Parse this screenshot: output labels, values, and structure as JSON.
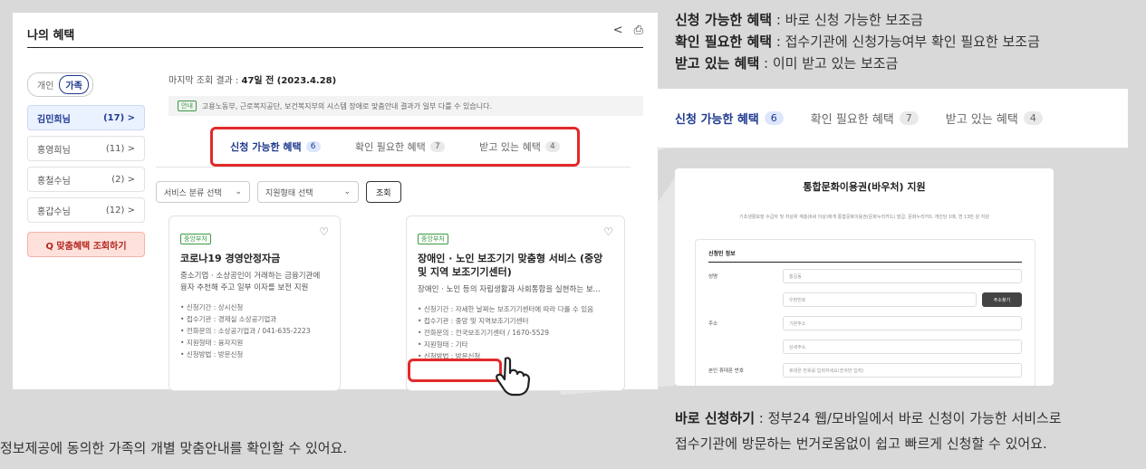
{
  "card": {
    "title": "나의 혜택",
    "toggle": {
      "personal": "개인",
      "family": "가족"
    },
    "people": [
      {
        "name": "김민희님",
        "count": "(17) >"
      },
      {
        "name": "홍영희님",
        "count": "(11) >"
      },
      {
        "name": "홍철수님",
        "count": "(2) >"
      },
      {
        "name": "홍갑수님",
        "count": "(12) >"
      }
    ],
    "match_button": "Q 맞춤혜택 조회하기",
    "last_query_prefix": "마지막 조회 결과 : ",
    "last_query_value": "47일 전 (2023.4.28)",
    "notice_tag": "안내",
    "notice_text": "고용노동부, 근로복지공단, 보건복지부의 시스템 장애로 맞춤안내 결과가 일부 다를 수 있습니다.",
    "tabs": [
      {
        "label": "신청 가능한 혜택",
        "count": "6"
      },
      {
        "label": "확인 필요한 혜택",
        "count": "7"
      },
      {
        "label": "받고 있는 혜택",
        "count": "4"
      }
    ],
    "filters": {
      "service_type": "서비스 분류 선택",
      "support_type": "지원형태 선택",
      "search": "조회"
    },
    "services": [
      {
        "tag": "중앙부처",
        "title": "코로나19 경영안정자금",
        "desc": "중소기업 · 소상공인이 거래하는 금융기관에 융자 추천해 주고 일부 이자를 보전 지원",
        "items": [
          "신청기간 : 상시신청",
          "접수기관 : 경제실 소상공기업과",
          "전화문의 : 소상공기업과 / 041-635-2223",
          "지원형태 : 융자지원",
          "신청방법 : 방문신청"
        ]
      },
      {
        "tag": "중앙부처",
        "title": "장애인 · 노인 보조기기 맞춤형 서비스 (중앙 및 지역 보조기기센터)",
        "desc": "장애인 · 노인 등의 자립생활과 사회통합을 실현하는 보...",
        "items": [
          "신청기간 : 자세한 날짜는 보조기기센터에 따라 다를 수 있음",
          "접수기관 : 중앙 및 지역보조기기센터",
          "전화문의 : 전국보조기기센터 / 1670-5529",
          "지원형태 : 기타",
          "신청방법 : 방문신청"
        ]
      }
    ]
  },
  "caption_left": "정보제공에 동의한 가족의 개별 맞춤안내를 확인할 수 있어요.",
  "legend": [
    {
      "term": "신청 가능한 혜택",
      "desc": " : 바로 신청 가능한 보조금"
    },
    {
      "term": "확인 필요한 혜택",
      "desc": " : 접수기관에 신청가능여부 확인 필요한 보조금"
    },
    {
      "term": "받고 있는 혜택",
      "desc": " : 이미 받고 있는 보조금"
    }
  ],
  "form": {
    "title": "통합문화이용권(바우처) 지원",
    "subtitle": "기초생활보장 수급자 및 차상위 계층(6세 이상)에게 통합문화이용권(문화누리카드) 발급, 문화누리카드 개인당 1매, 연 13만 원 지원",
    "section": "신청인 정보",
    "rows": [
      {
        "label": "성명",
        "value": "홍길동"
      },
      {
        "label": "",
        "value": "우편번호",
        "button": "주소찾기"
      },
      {
        "label": "주소",
        "value": "기본주소"
      },
      {
        "label": "",
        "value": "상세주소"
      },
      {
        "label": "본인 휴대폰 번호",
        "value": "휴대폰 번호를 입력하세요(숫자만 입력)"
      }
    ]
  },
  "caption_right": {
    "term": "바로 신청하기",
    "line1": " : 정부24 웹/모바일에서 바로 신청이 가능한 서비스로",
    "line2": "접수기관에 방문하는 번거로움없이 쉽고 빠르게 신청할 수 있어요."
  },
  "colors": {
    "accent": "#1f3a8f",
    "highlight": "#e22a2a",
    "tag": "#3a9b44"
  }
}
